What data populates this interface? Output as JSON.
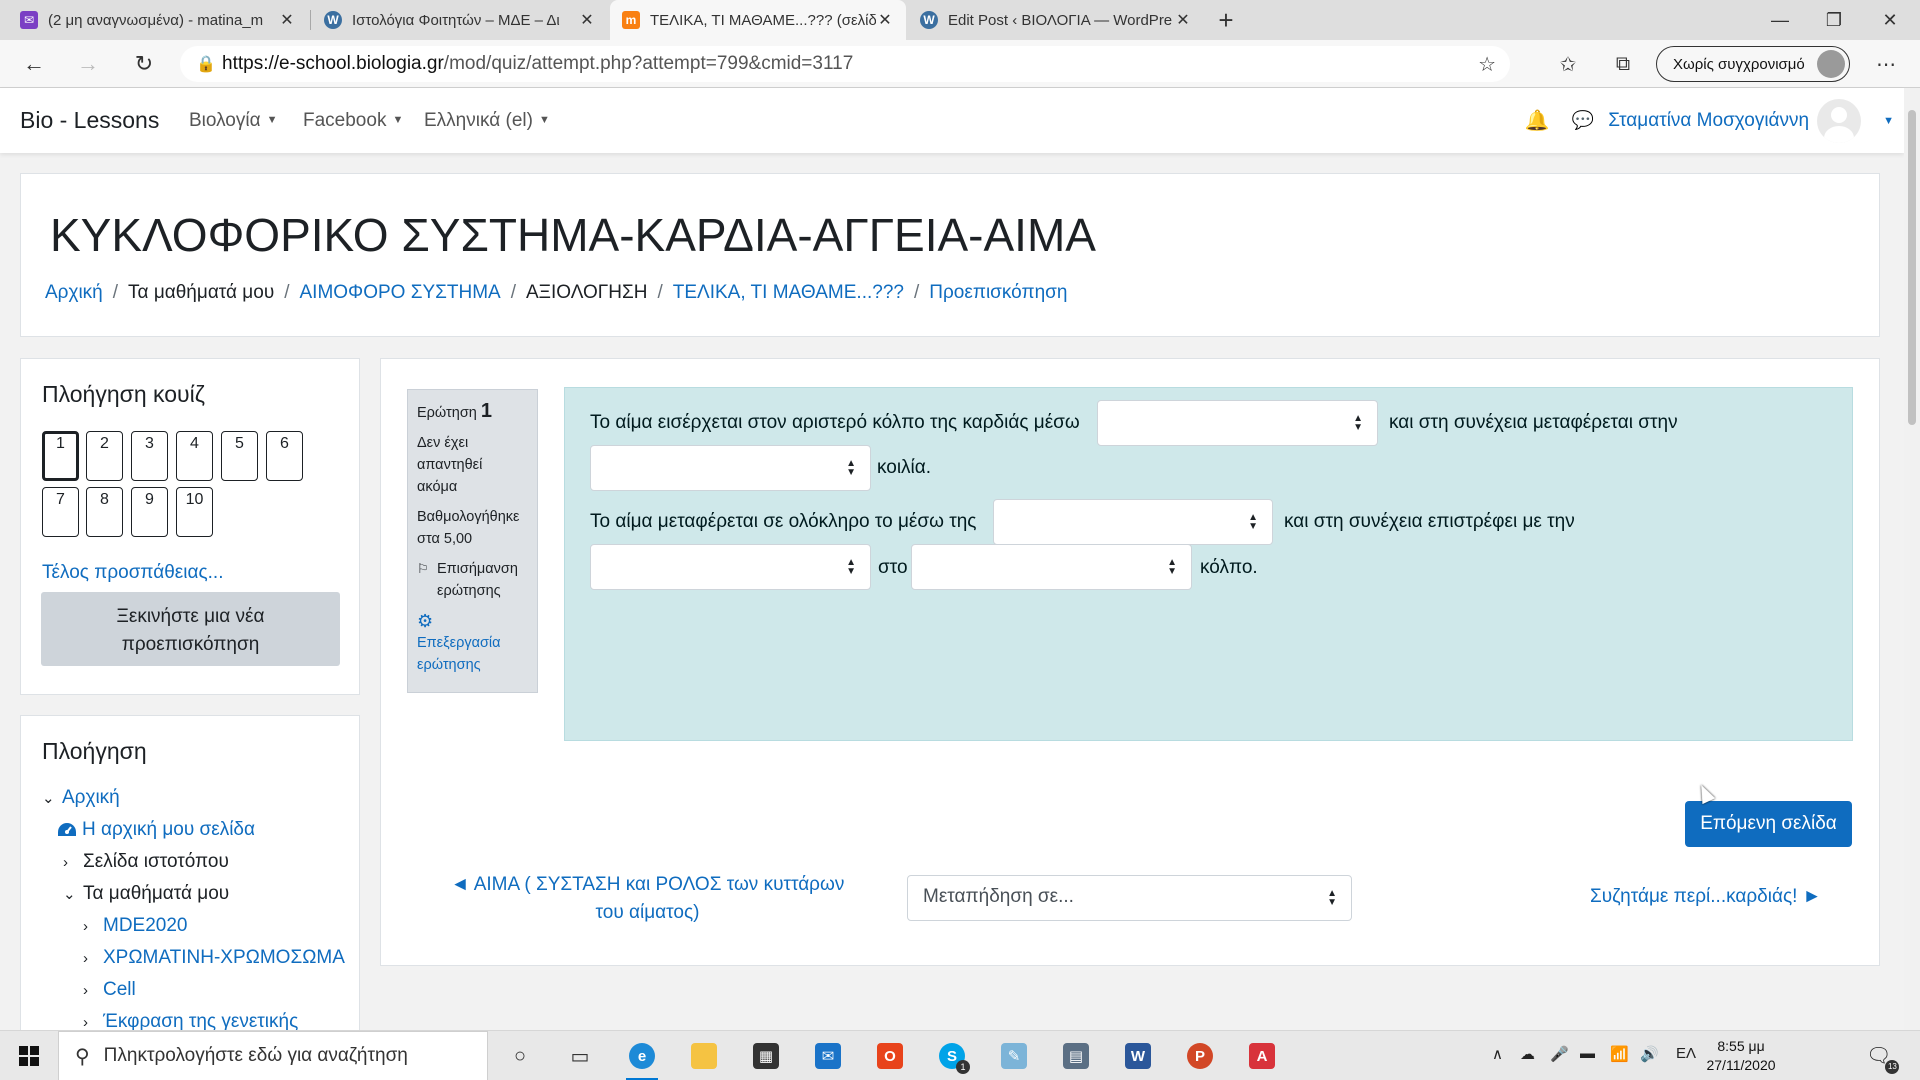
{
  "browser": {
    "tabs": [
      {
        "title": "(2 μη αναγνωσμένα) - matina_m",
        "favicon": "mail-icon",
        "active": false
      },
      {
        "title": "Ιστολόγια Φοιτητών – ΜΔΕ – Δι",
        "favicon": "wordpress-icon",
        "active": false
      },
      {
        "title": "ΤΕΛΙΚΑ, ΤΙ ΜΑΘΑΜΕ...??? (σελίδα",
        "favicon": "moodle-icon",
        "active": true
      },
      {
        "title": "Edit Post ‹ ΒΙΟΛΟΓΙΑ — WordPre",
        "favicon": "wordpress-icon",
        "active": false
      }
    ],
    "url_host": "https://e-school.biologia.gr",
    "url_path": "/mod/quiz/attempt.php?attempt=799&cmid=3117",
    "sync_label": "Χωρίς συγχρονισμό"
  },
  "navbar": {
    "brand": "Bio - Lessons",
    "menus": [
      "Βιολογία",
      "Facebook",
      "Ελληνικά (el)"
    ],
    "username": "Σταματίνα Μοσχογιάννη"
  },
  "header": {
    "title": "ΚΥΚΛΟΦΟΡΙΚΟ ΣΥΣΤΗΜΑ-ΚΑΡΔΙΑ-ΑΓΓΕΙΑ-ΑΙΜΑ",
    "breadcrumb": [
      {
        "label": "Αρχική",
        "link": true
      },
      {
        "label": "Τα μαθήματά μου",
        "link": false
      },
      {
        "label": "ΑΙΜΟΦΟΡΟ ΣΥΣΤΗΜΑ",
        "link": true
      },
      {
        "label": "ΑΞΙΟΛΟΓΗΣΗ",
        "link": false
      },
      {
        "label": "ΤΕΛΙΚΑ, ΤΙ ΜΑΘΑΜΕ...???",
        "link": true
      },
      {
        "label": "Προεπισκόπηση",
        "link": true
      }
    ]
  },
  "quiz_nav": {
    "title": "Πλοήγηση κουίζ",
    "questions": [
      "1",
      "2",
      "3",
      "4",
      "5",
      "6",
      "7",
      "8",
      "9",
      "10"
    ],
    "current": "1",
    "finish_link": "Τέλος προσπάθειας...",
    "new_preview_line1": "Ξεκινήστε μια νέα",
    "new_preview_line2": "προεπισκόπηση"
  },
  "navigation": {
    "title": "Πλοήγηση",
    "items": [
      {
        "label": "Αρχική",
        "link": true,
        "chevron": "down"
      },
      {
        "label": "Η αρχική μου σελίδα",
        "link": true,
        "chevron": "dashboard"
      },
      {
        "label": "Σελίδα ιστοτόπου",
        "link": false,
        "chevron": "right"
      },
      {
        "label": "Τα μαθήματά μου",
        "link": false,
        "chevron": "down"
      },
      {
        "label": "MDE2020",
        "link": true,
        "chevron": "right"
      },
      {
        "label": "ΧΡΩΜΑΤΙΝΗ-ΧΡΩΜΟΣΩΜΑ",
        "link": true,
        "chevron": "right"
      },
      {
        "label": "Cell",
        "link": true,
        "chevron": "right"
      },
      {
        "label": "Έκφραση της γενετικής",
        "link": true,
        "chevron": "right"
      }
    ]
  },
  "question": {
    "label": "Ερώτηση",
    "number": "1",
    "status_1": "Δεν έχει",
    "status_2": "απαντηθεί",
    "status_3": "ακόμα",
    "grade_1": "Βαθμολογήθηκε",
    "grade_2": "στα 5,00",
    "flag_1": "Επισήμανση",
    "flag_2": "ερώτησης",
    "edit_1": "Επεξεργασία",
    "edit_2": "ερώτησης",
    "text_1": "Το αίμα εισέρχεται στον αριστερό κόλπο της καρδιάς μέσω",
    "text_2": "και στη συνέχεια μεταφέρεται στην",
    "text_3": "κοιλία.",
    "text_4": "Το αίμα μεταφέρεται σε ολόκληρο το μέσω της",
    "text_5": "και στη συνέχεια επιστρέφει με την",
    "text_6": "στο",
    "text_7": "κόλπο."
  },
  "nav_bottom": {
    "next_button": "Επόμενη σελίδα",
    "prev_link_1": "◄ ΑΙΜΑ ( ΣΥΣΤΑΣΗ και ΡΟΛΟΣ των κυττάρων",
    "prev_link_2": "του αίματος)",
    "jump_placeholder": "Μεταπήδηση σε...",
    "next_link": "Συζητάμε περί...καρδιάς! ►"
  },
  "taskbar": {
    "search_placeholder": "Πληκτρολογήστε εδώ για αναζήτηση",
    "lang": "ΕΛ",
    "time": "8:55 μμ",
    "date": "27/11/2020",
    "skype_badge": "1",
    "notif_count": "13"
  },
  "colors": {
    "accent": "#0f6cbf",
    "question_bg": "#cfe8ea",
    "info_bg": "#dee2e6"
  }
}
